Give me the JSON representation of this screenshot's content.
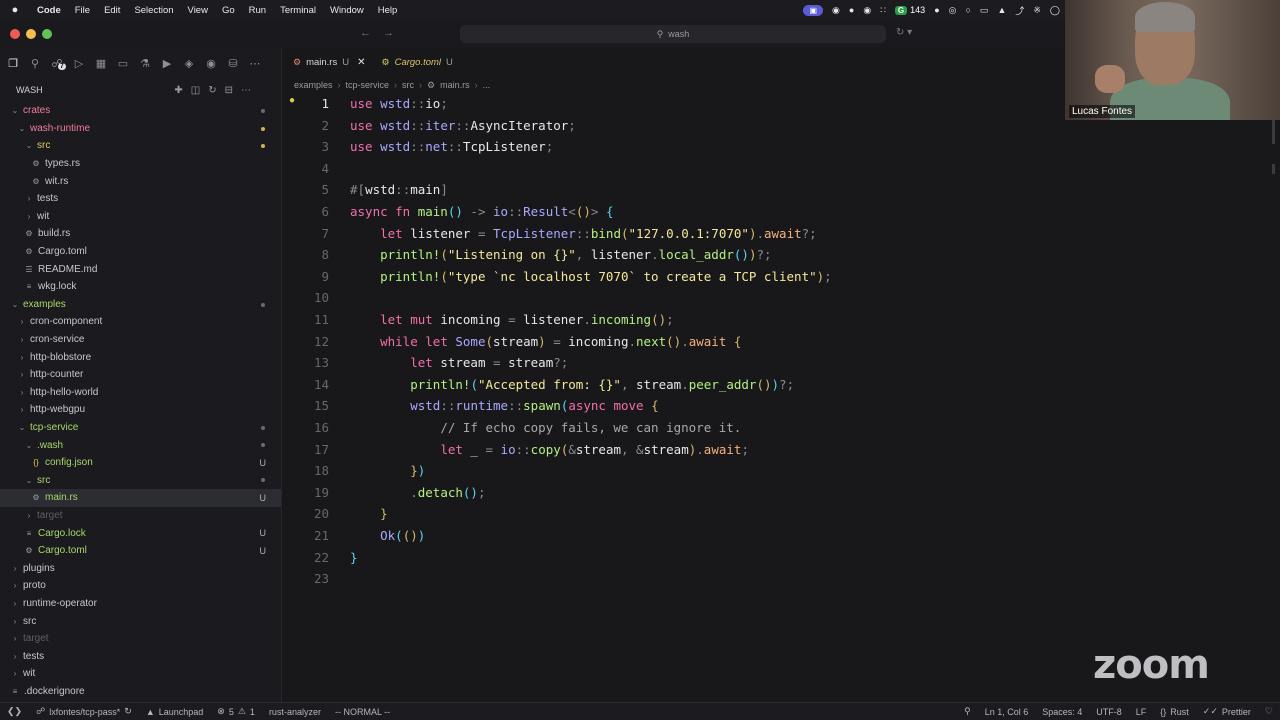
{
  "menubar": {
    "apple": "",
    "items": [
      "Code",
      "File",
      "Edit",
      "Selection",
      "View",
      "Go",
      "Run",
      "Terminal",
      "Window",
      "Help"
    ],
    "tray_count": "143"
  },
  "titlebar": {
    "search_text": "wash"
  },
  "sidebar": {
    "badge_count": "7",
    "explorer_title": "WASH"
  },
  "tree": [
    {
      "label": "crates",
      "depth": 0,
      "kind": "folder-open",
      "color": "pink",
      "status": "dot"
    },
    {
      "label": "wash-runtime",
      "depth": 1,
      "kind": "folder-open",
      "color": "pink",
      "status": "dot-y"
    },
    {
      "label": "src",
      "depth": 2,
      "kind": "folder-open",
      "color": "yellow",
      "status": "dot-y"
    },
    {
      "label": "types.rs",
      "depth": 3,
      "kind": "file-rs",
      "color": "",
      "status": ""
    },
    {
      "label": "wit.rs",
      "depth": 3,
      "kind": "file-rs",
      "color": "",
      "status": ""
    },
    {
      "label": "tests",
      "depth": 2,
      "kind": "folder",
      "color": "",
      "status": ""
    },
    {
      "label": "wit",
      "depth": 2,
      "kind": "folder",
      "color": "",
      "status": ""
    },
    {
      "label": "build.rs",
      "depth": 2,
      "kind": "file-rs",
      "color": "",
      "status": ""
    },
    {
      "label": "Cargo.toml",
      "depth": 2,
      "kind": "file-gear",
      "color": "",
      "status": ""
    },
    {
      "label": "README.md",
      "depth": 2,
      "kind": "file-md",
      "color": "",
      "status": ""
    },
    {
      "label": "wkg.lock",
      "depth": 2,
      "kind": "file-lines",
      "color": "",
      "status": ""
    },
    {
      "label": "examples",
      "depth": 0,
      "kind": "folder-open",
      "color": "green",
      "status": "dot"
    },
    {
      "label": "cron-component",
      "depth": 1,
      "kind": "folder",
      "color": "",
      "status": ""
    },
    {
      "label": "cron-service",
      "depth": 1,
      "kind": "folder",
      "color": "",
      "status": ""
    },
    {
      "label": "http-blobstore",
      "depth": 1,
      "kind": "folder",
      "color": "",
      "status": ""
    },
    {
      "label": "http-counter",
      "depth": 1,
      "kind": "folder",
      "color": "",
      "status": ""
    },
    {
      "label": "http-hello-world",
      "depth": 1,
      "kind": "folder",
      "color": "",
      "status": ""
    },
    {
      "label": "http-webgpu",
      "depth": 1,
      "kind": "folder",
      "color": "",
      "status": ""
    },
    {
      "label": "tcp-service",
      "depth": 1,
      "kind": "folder-open",
      "color": "green",
      "status": "dot"
    },
    {
      "label": ".wash",
      "depth": 2,
      "kind": "folder-open",
      "color": "green",
      "status": "dot"
    },
    {
      "label": "config.json",
      "depth": 3,
      "kind": "file-json",
      "color": "green",
      "status": "U"
    },
    {
      "label": "src",
      "depth": 2,
      "kind": "folder-open",
      "color": "green",
      "status": "dot"
    },
    {
      "label": "main.rs",
      "depth": 3,
      "kind": "file-rs",
      "color": "green",
      "status": "U",
      "selected": true
    },
    {
      "label": "target",
      "depth": 2,
      "kind": "folder",
      "color": "muted",
      "status": ""
    },
    {
      "label": "Cargo.lock",
      "depth": 2,
      "kind": "file-lines",
      "color": "green",
      "status": "U"
    },
    {
      "label": "Cargo.toml",
      "depth": 2,
      "kind": "file-gear",
      "color": "green",
      "status": "U"
    },
    {
      "label": "plugins",
      "depth": 0,
      "kind": "folder",
      "color": "",
      "status": ""
    },
    {
      "label": "proto",
      "depth": 0,
      "kind": "folder",
      "color": "",
      "status": ""
    },
    {
      "label": "runtime-operator",
      "depth": 0,
      "kind": "folder",
      "color": "",
      "status": ""
    },
    {
      "label": "src",
      "depth": 0,
      "kind": "folder",
      "color": "",
      "status": ""
    },
    {
      "label": "target",
      "depth": 0,
      "kind": "folder",
      "color": "muted",
      "status": ""
    },
    {
      "label": "tests",
      "depth": 0,
      "kind": "folder",
      "color": "",
      "status": ""
    },
    {
      "label": "wit",
      "depth": 0,
      "kind": "folder",
      "color": "",
      "status": ""
    },
    {
      "label": ".dockerignore",
      "depth": 0,
      "kind": "file-lines",
      "color": "",
      "status": ""
    }
  ],
  "tabs": [
    {
      "name": "main.rs",
      "status": "U",
      "active": true
    },
    {
      "name": "Cargo.toml",
      "status": "U",
      "active": false
    }
  ],
  "breadcrumb": [
    "examples",
    "tcp-service",
    "src",
    "main.rs",
    "..."
  ],
  "code_lines": [
    [
      [
        "kw",
        "use "
      ],
      [
        "ns",
        "wstd"
      ],
      [
        "pn",
        "::"
      ],
      [
        "ty",
        "io"
      ],
      [
        "pn",
        ";"
      ]
    ],
    [
      [
        "kw",
        "use "
      ],
      [
        "ns",
        "wstd"
      ],
      [
        "pn",
        "::"
      ],
      [
        "ns",
        "iter"
      ],
      [
        "pn",
        "::"
      ],
      [
        "ty",
        "AsyncIterator"
      ],
      [
        "pn",
        ";"
      ]
    ],
    [
      [
        "kw",
        "use "
      ],
      [
        "ns",
        "wstd"
      ],
      [
        "pn",
        "::"
      ],
      [
        "ns",
        "net"
      ],
      [
        "pn",
        "::"
      ],
      [
        "ty",
        "TcpListener"
      ],
      [
        "pn",
        ";"
      ]
    ],
    [],
    [
      [
        "pn",
        "#["
      ],
      [
        "ty",
        "wstd"
      ],
      [
        "pn",
        "::"
      ],
      [
        "ty",
        "main"
      ],
      [
        "pn",
        "]"
      ]
    ],
    [
      [
        "kw",
        "async fn "
      ],
      [
        "fn",
        "main"
      ],
      [
        "br",
        "()"
      ],
      [
        "pn",
        " -> "
      ],
      [
        "ns",
        "io"
      ],
      [
        "pn",
        "::"
      ],
      [
        "ns",
        "Result"
      ],
      [
        "pn",
        "<"
      ],
      [
        "br2",
        "()"
      ],
      [
        "pn",
        "> "
      ],
      [
        "br",
        "{"
      ]
    ],
    [
      [
        "ty",
        "    "
      ],
      [
        "kw",
        "let "
      ],
      [
        "ty",
        "listener "
      ],
      [
        "pn",
        "= "
      ],
      [
        "ns",
        "TcpListener"
      ],
      [
        "pn",
        "::"
      ],
      [
        "fn",
        "bind"
      ],
      [
        "br2",
        "("
      ],
      [
        "st",
        "\"127.0.0.1:7070\""
      ],
      [
        "br2",
        ")"
      ],
      [
        "pn",
        "."
      ],
      [
        "aw",
        "await"
      ],
      [
        "pn",
        "?;"
      ]
    ],
    [
      [
        "ty",
        "    "
      ],
      [
        "mc",
        "println!"
      ],
      [
        "br2",
        "("
      ],
      [
        "st",
        "\"Listening on {}\""
      ],
      [
        "pn",
        ", "
      ],
      [
        "ty",
        "listener"
      ],
      [
        "pn",
        "."
      ],
      [
        "fn",
        "local_addr"
      ],
      [
        "br",
        "()"
      ],
      [
        "br2",
        ")"
      ],
      [
        "pn",
        "?;"
      ]
    ],
    [
      [
        "ty",
        "    "
      ],
      [
        "mc",
        "println!"
      ],
      [
        "br2",
        "("
      ],
      [
        "st",
        "\"type `nc localhost 7070` to create a TCP client\""
      ],
      [
        "br2",
        ")"
      ],
      [
        "pn",
        ";"
      ]
    ],
    [],
    [
      [
        "ty",
        "    "
      ],
      [
        "kw",
        "let mut "
      ],
      [
        "ty",
        "incoming "
      ],
      [
        "pn",
        "= "
      ],
      [
        "ty",
        "listener"
      ],
      [
        "pn",
        "."
      ],
      [
        "fn",
        "incoming"
      ],
      [
        "br2",
        "()"
      ],
      [
        "pn",
        ";"
      ]
    ],
    [
      [
        "ty",
        "    "
      ],
      [
        "kw",
        "while let "
      ],
      [
        "ns",
        "Some"
      ],
      [
        "br2",
        "("
      ],
      [
        "ty",
        "stream"
      ],
      [
        "br2",
        ")"
      ],
      [
        "pn",
        " = "
      ],
      [
        "ty",
        "incoming"
      ],
      [
        "pn",
        "."
      ],
      [
        "fn",
        "next"
      ],
      [
        "br2",
        "()"
      ],
      [
        "pn",
        "."
      ],
      [
        "aw",
        "await"
      ],
      [
        "br2",
        " {"
      ]
    ],
    [
      [
        "ty",
        "        "
      ],
      [
        "kw",
        "let "
      ],
      [
        "ty",
        "stream "
      ],
      [
        "pn",
        "= "
      ],
      [
        "ty",
        "stream"
      ],
      [
        "pn",
        "?;"
      ]
    ],
    [
      [
        "ty",
        "        "
      ],
      [
        "mc",
        "println!"
      ],
      [
        "br",
        "("
      ],
      [
        "st",
        "\"Accepted from: {}\""
      ],
      [
        "pn",
        ", "
      ],
      [
        "ty",
        "stream"
      ],
      [
        "pn",
        "."
      ],
      [
        "fn",
        "peer_addr"
      ],
      [
        "br2",
        "()"
      ],
      [
        "br",
        ")"
      ],
      [
        "pn",
        "?;"
      ]
    ],
    [
      [
        "ty",
        "        "
      ],
      [
        "ns",
        "wstd"
      ],
      [
        "pn",
        "::"
      ],
      [
        "ns",
        "runtime"
      ],
      [
        "pn",
        "::"
      ],
      [
        "fn",
        "spawn"
      ],
      [
        "br",
        "("
      ],
      [
        "kw",
        "async move "
      ],
      [
        "br2",
        "{"
      ]
    ],
    [
      [
        "ty",
        "            "
      ],
      [
        "cm",
        "// If echo copy fails, we can ignore it."
      ]
    ],
    [
      [
        "ty",
        "            "
      ],
      [
        "kw",
        "let "
      ],
      [
        "ty",
        "_ "
      ],
      [
        "pn",
        "= "
      ],
      [
        "ns",
        "io"
      ],
      [
        "pn",
        "::"
      ],
      [
        "fn",
        "copy"
      ],
      [
        "br2",
        "("
      ],
      [
        "pn",
        "&"
      ],
      [
        "ty",
        "stream"
      ],
      [
        "pn",
        ", &"
      ],
      [
        "ty",
        "stream"
      ],
      [
        "br2",
        ")"
      ],
      [
        "pn",
        "."
      ],
      [
        "aw",
        "await"
      ],
      [
        "pn",
        ";"
      ]
    ],
    [
      [
        "ty",
        "        "
      ],
      [
        "br2",
        "}"
      ],
      [
        "br",
        ")"
      ]
    ],
    [
      [
        "ty",
        "        "
      ],
      [
        "pn",
        "."
      ],
      [
        "fn",
        "detach"
      ],
      [
        "br",
        "()"
      ],
      [
        "pn",
        ";"
      ]
    ],
    [
      [
        "ty",
        "    "
      ],
      [
        "br2",
        "}"
      ]
    ],
    [
      [
        "ty",
        "    "
      ],
      [
        "ns",
        "Ok"
      ],
      [
        "br",
        "("
      ],
      [
        "br2",
        "()"
      ],
      [
        "br",
        ")"
      ]
    ],
    [
      [
        "br",
        "}"
      ]
    ],
    []
  ],
  "current_line": 1,
  "webcam": {
    "name": "Lucas Fontes"
  },
  "watermark": "zoom",
  "statusbar": {
    "branch": "lxfontes/tcp-pass*",
    "launchpad": "Launchpad",
    "errors": "5",
    "warnings": "1",
    "lsp": "rust-analyzer",
    "mode": "-- NORMAL --",
    "position": "Ln 1, Col 6",
    "spaces": "Spaces: 4",
    "encoding": "UTF-8",
    "eol": "LF",
    "language": "Rust",
    "formatter": "Prettier"
  }
}
